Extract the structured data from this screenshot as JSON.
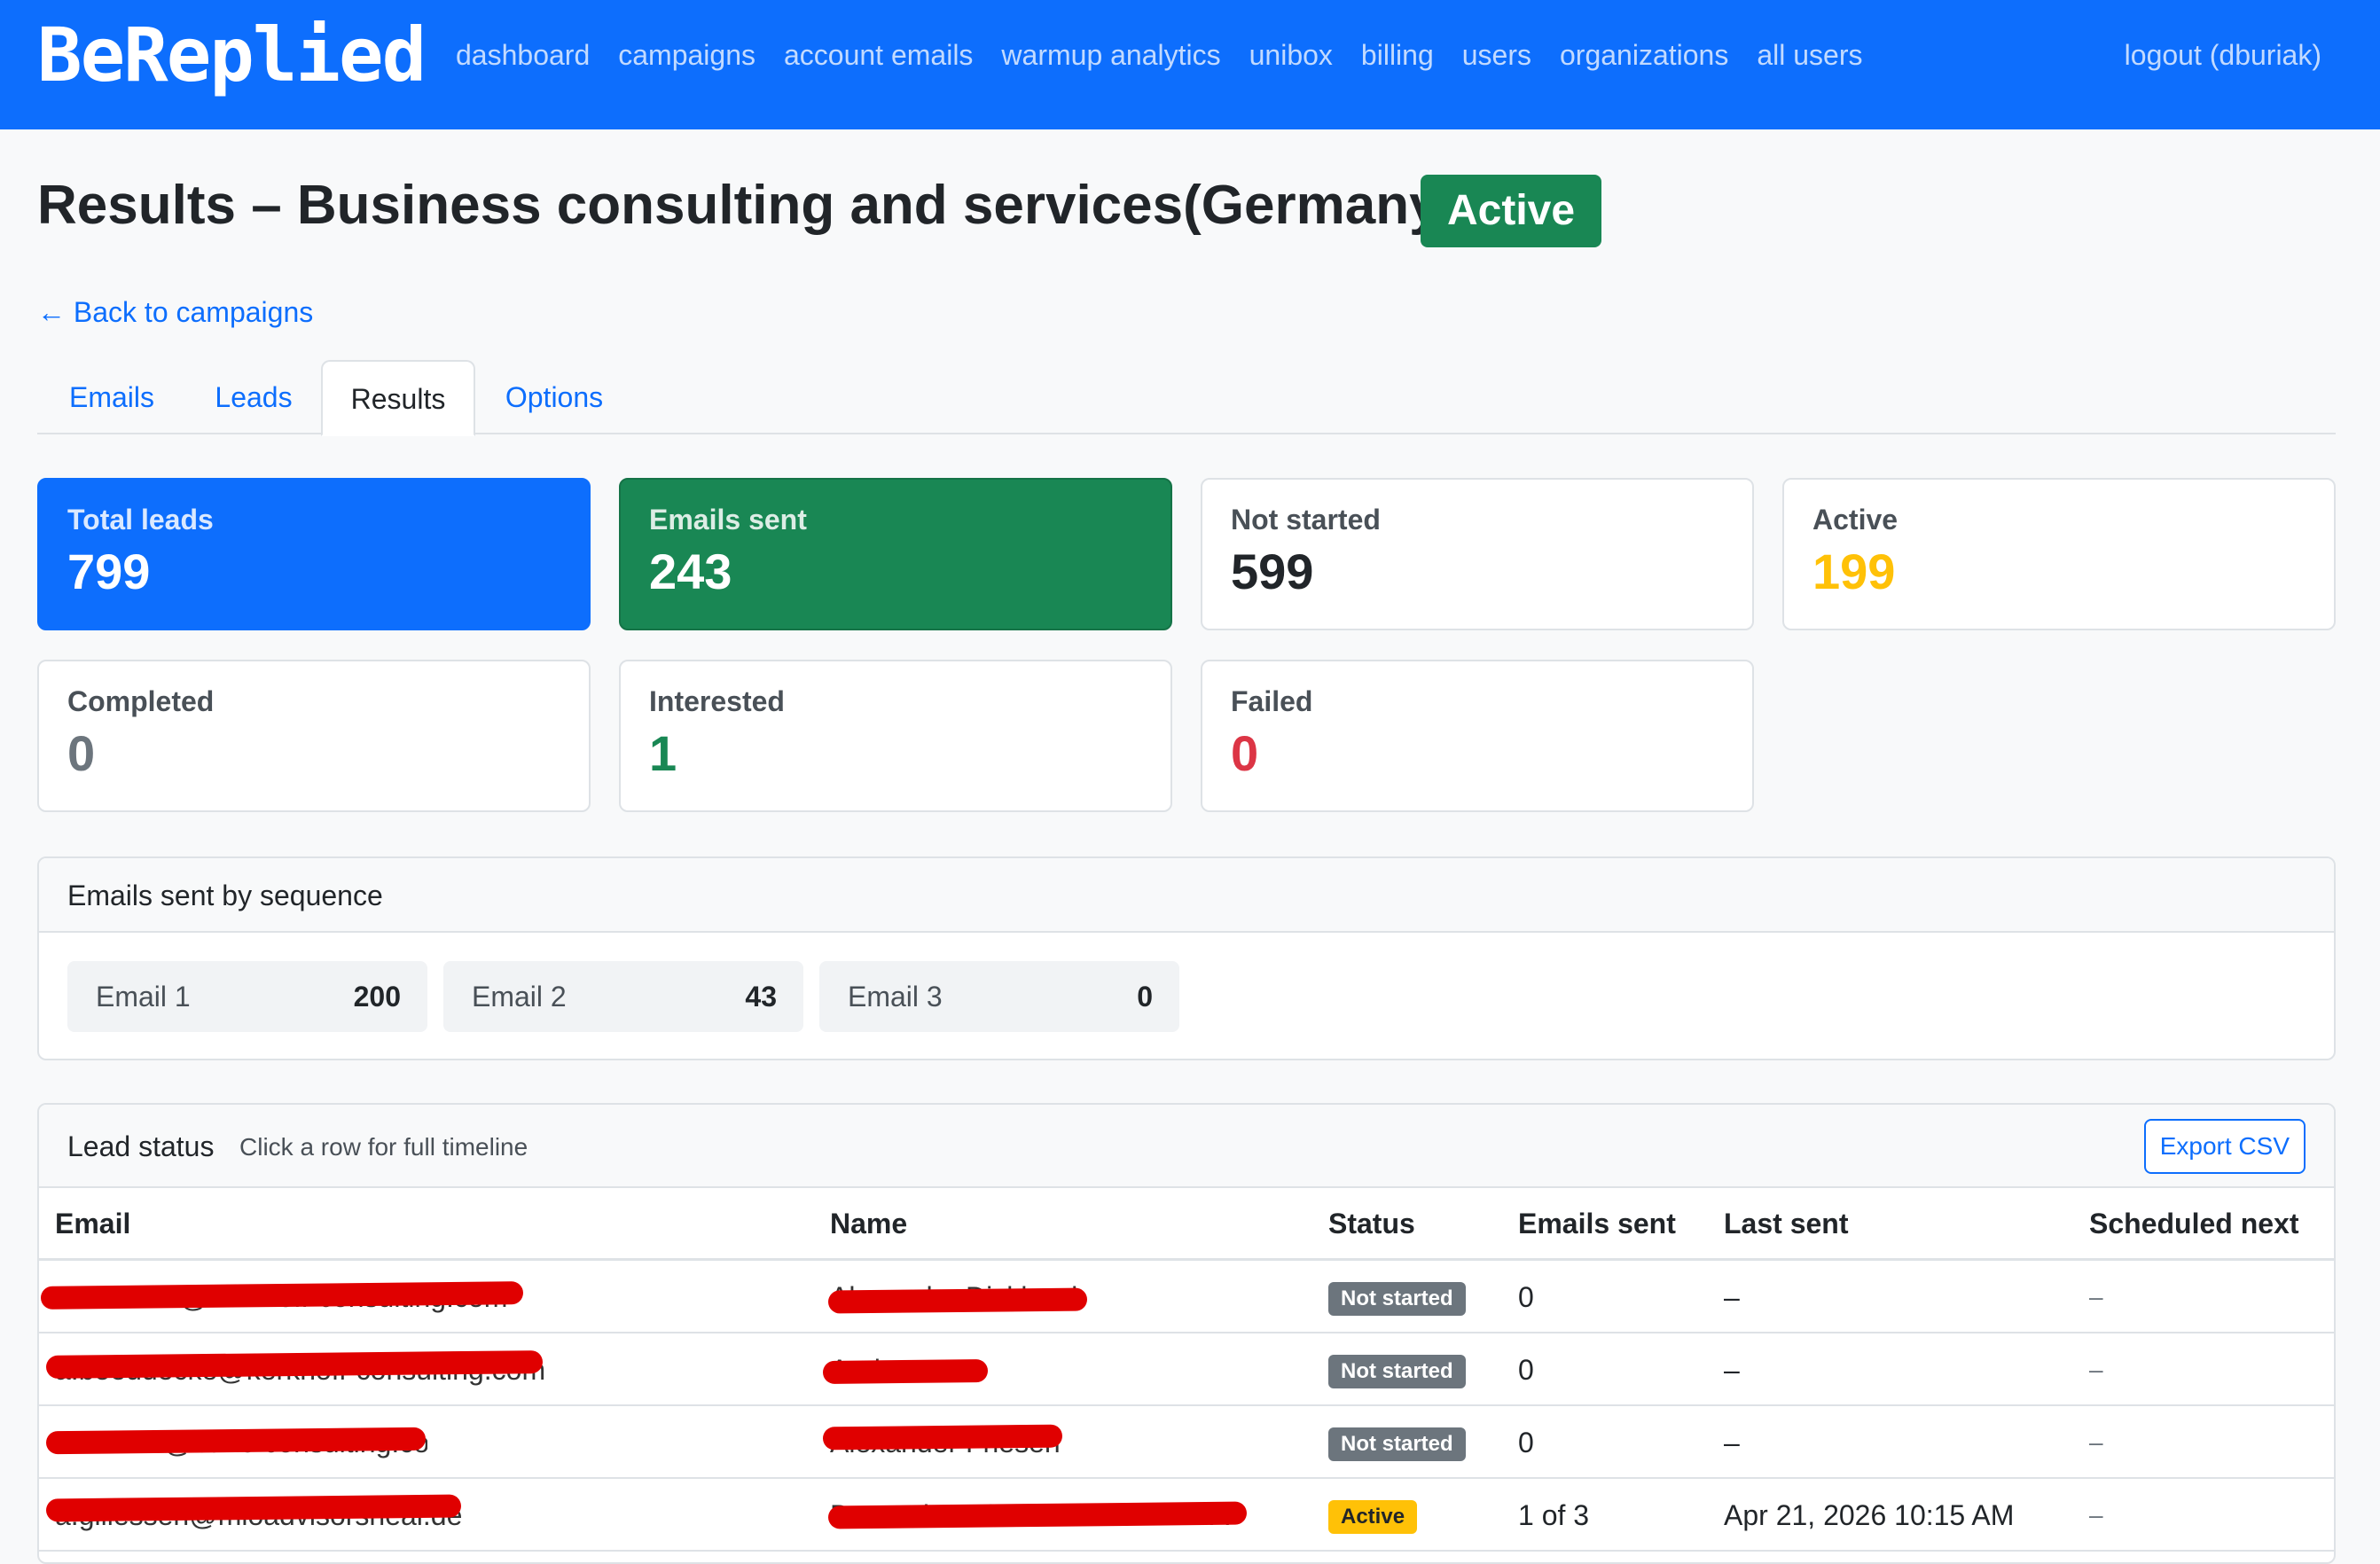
{
  "navbar": {
    "brand": "BeReplied",
    "links": [
      "dashboard",
      "campaigns",
      "account emails",
      "warmup analytics",
      "unibox",
      "billing",
      "users",
      "organizations",
      "all users"
    ],
    "logout": "logout (dburiak)"
  },
  "header": {
    "title": "Results – Business consulting and services(Germany)",
    "status_badge": "Active",
    "back_link": "← Back to campaigns"
  },
  "tabs": [
    {
      "label": "Emails",
      "active": false
    },
    {
      "label": "Leads",
      "active": false
    },
    {
      "label": "Results",
      "active": true
    },
    {
      "label": "Options",
      "active": false
    }
  ],
  "stats": [
    {
      "label": "Total leads",
      "value": "799",
      "style": "primary",
      "color": "#ffffff"
    },
    {
      "label": "Emails sent",
      "value": "243",
      "style": "success",
      "color": "#ffffff"
    },
    {
      "label": "Not started",
      "value": "599",
      "style": "plain",
      "color": "#212529"
    },
    {
      "label": "Active",
      "value": "199",
      "style": "plain",
      "color": "#ffc107"
    },
    {
      "label": "Completed",
      "value": "0",
      "style": "plain",
      "color": "#6c757d"
    },
    {
      "label": "Interested",
      "value": "1",
      "style": "plain",
      "color": "#198754"
    },
    {
      "label": "Failed",
      "value": "0",
      "style": "plain",
      "color": "#dc3545"
    }
  ],
  "sequence": {
    "title": "Emails sent by sequence",
    "items": [
      {
        "label": "Email 1",
        "count": "200"
      },
      {
        "label": "Email 2",
        "count": "43"
      },
      {
        "label": "Email 3",
        "count": "0"
      }
    ]
  },
  "lead_status": {
    "title": "Lead status",
    "subtitle": "Click a row for full timeline",
    "export_label": "Export CSV",
    "columns": [
      "Email",
      "Name",
      "Status",
      "Emails sent",
      "Last sent",
      "Scheduled next"
    ],
    "rows": [
      {
        "email": "alexander@kerkhoff-consulting.com",
        "name": "Alexander Dickhardt",
        "status": "Not started",
        "status_color": "#6c757d",
        "sent": "0",
        "last": "–",
        "next": "–"
      },
      {
        "email": "a.boeddecke@kerkhoff-consulting.com",
        "name": "Andreas D.",
        "status": "Not started",
        "status_color": "#6c757d",
        "sent": "0",
        "last": "–",
        "next": "–"
      },
      {
        "email": "a.friesen@banc-consulting.com",
        "name": "Alexander Friesen",
        "status": "Not started",
        "status_color": "#6c757d",
        "sent": "0",
        "last": "–",
        "next": "–"
      },
      {
        "email": "a.gillessen@mioadvisorsheal.de",
        "name": "Dr. med. Andrea Gillessen MBA",
        "status": "Active",
        "status_color": "#ffc107",
        "sent": "1 of 3",
        "last": "Apr 21, 2026 10:15 AM",
        "next": "–"
      }
    ]
  }
}
